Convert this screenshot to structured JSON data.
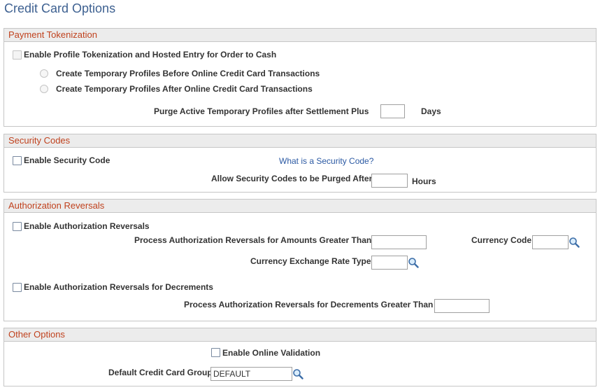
{
  "page": {
    "title": "Credit Card Options"
  },
  "tokenization": {
    "header": "Payment Tokenization",
    "enable_label": "Enable Profile Tokenization and Hosted Entry for Order to Cash",
    "radio_before": "Create Temporary Profiles Before Online Credit Card Transactions",
    "radio_after": "Create Temporary Profiles After Online Credit Card Transactions",
    "purge_label": "Purge Active Temporary Profiles after Settlement Plus",
    "purge_value": "",
    "days_label": "Days"
  },
  "security": {
    "header": "Security Codes",
    "enable_label": "Enable Security Code",
    "help_link": "What is a Security Code?",
    "purge_label": "Allow Security Codes to be Purged After",
    "purge_value": "",
    "hours_label": "Hours"
  },
  "reversals": {
    "header": "Authorization Reversals",
    "enable_label": "Enable Authorization Reversals",
    "amount_label": "Process Authorization Reversals for Amounts Greater Than",
    "amount_value": "",
    "currency_label": "Currency Code",
    "currency_value": "",
    "rate_type_label": "Currency Exchange Rate Type",
    "rate_type_value": "",
    "decrements_enable_label": "Enable Authorization Reversals for Decrements",
    "decrements_label": "Process Authorization Reversals for Decrements Greater Than",
    "decrements_value": ""
  },
  "other": {
    "header": "Other Options",
    "online_validation_label": "Enable Online Validation",
    "default_group_label": "Default Credit Card Group",
    "default_group_value": "DEFAULT"
  },
  "icons": {
    "lookup": "magnifier-icon"
  },
  "colors": {
    "title": "#3e6191",
    "section_header_text": "#c0421e",
    "section_header_bg": "#ececec",
    "link": "#2b59a3"
  }
}
